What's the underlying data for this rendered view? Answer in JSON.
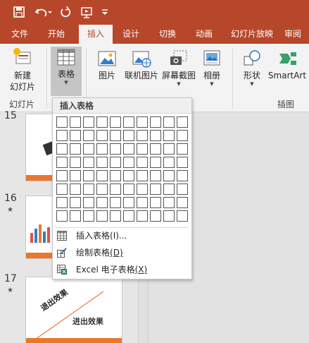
{
  "quick_access": {
    "save_icon": "save-icon",
    "undo_icon": "undo-icon",
    "redo_icon": "redo-icon",
    "present_icon": "start-from-beginning-icon",
    "customize_icon": "customize-qat-icon"
  },
  "tabs": [
    {
      "label": "文件"
    },
    {
      "label": "开始"
    },
    {
      "label": "插入",
      "active": true
    },
    {
      "label": "设计"
    },
    {
      "label": "切换"
    },
    {
      "label": "动画"
    },
    {
      "label": "幻灯片放映"
    },
    {
      "label": "审阅"
    }
  ],
  "ribbon": {
    "new_slide_line1": "新建",
    "new_slide_line2": "幻灯片",
    "table_label": "表格",
    "picture_label": "图片",
    "online_picture_label": "联机图片",
    "screenshot_label": "屏幕截图",
    "album_label": "相册",
    "shapes_label": "形状",
    "smartart_label": "SmartArt",
    "group_slides": "幻灯片",
    "group_illustrations": "插图"
  },
  "thumbnails": {
    "slides": [
      {
        "number": "15",
        "has_star": false
      },
      {
        "number": "16",
        "has_star": true,
        "star": "★"
      },
      {
        "number": "17",
        "has_star": true,
        "star": "★",
        "diagonal_text": "退出效果",
        "caption": "进出效果"
      }
    ]
  },
  "dropdown": {
    "header": "插入表格",
    "grid": {
      "cols": 10,
      "rows": 8
    },
    "items": [
      {
        "label": "插入表格",
        "hotkey_text": "(I)...",
        "icon": "insert-table-icon"
      },
      {
        "label": "绘制表格",
        "hotkey_text": "(D)",
        "icon": "draw-table-icon"
      },
      {
        "label": "Excel 电子表格",
        "hotkey_text": "(X)",
        "icon": "excel-spreadsheet-icon"
      }
    ]
  },
  "colors": {
    "accent": "#b7472a",
    "ribbon_bg": "#f3f3f3",
    "slide_bar": "#e9772e"
  }
}
